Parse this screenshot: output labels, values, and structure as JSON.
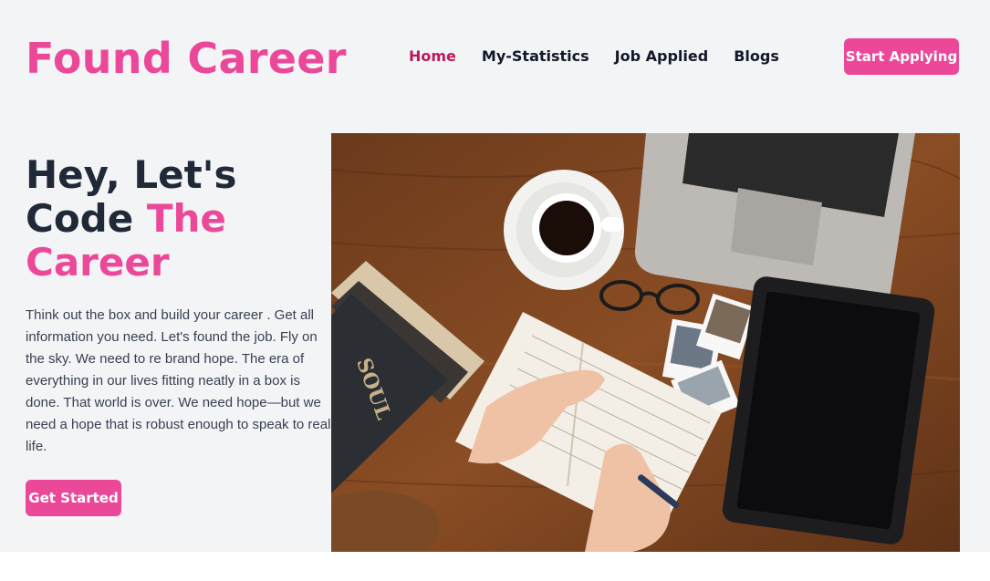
{
  "header": {
    "brand": "Found Career",
    "nav": [
      {
        "label": "Home",
        "active": true
      },
      {
        "label": "My-Statistics",
        "active": false
      },
      {
        "label": "Job Applied",
        "active": false
      },
      {
        "label": "Blogs",
        "active": false
      }
    ],
    "cta_label": "Start Applying"
  },
  "hero": {
    "title_part1": "Hey, Let's Code ",
    "title_highlight": "The Career",
    "description": "Think out the box and build your career . Get all information you need. Let's found the job. Fly on the sky. We need to re brand hope. The era of everything in our lives fitting neatly in a box is done. That world is over. We need hope—but we need a hope that is robust enough to speak to real life.",
    "cta_label": "Get Started",
    "image_book_text": "SOUL"
  },
  "colors": {
    "accent": "#ec4899",
    "nav_active": "#be185d",
    "background": "#f3f4f6",
    "heading": "#1f2937"
  }
}
